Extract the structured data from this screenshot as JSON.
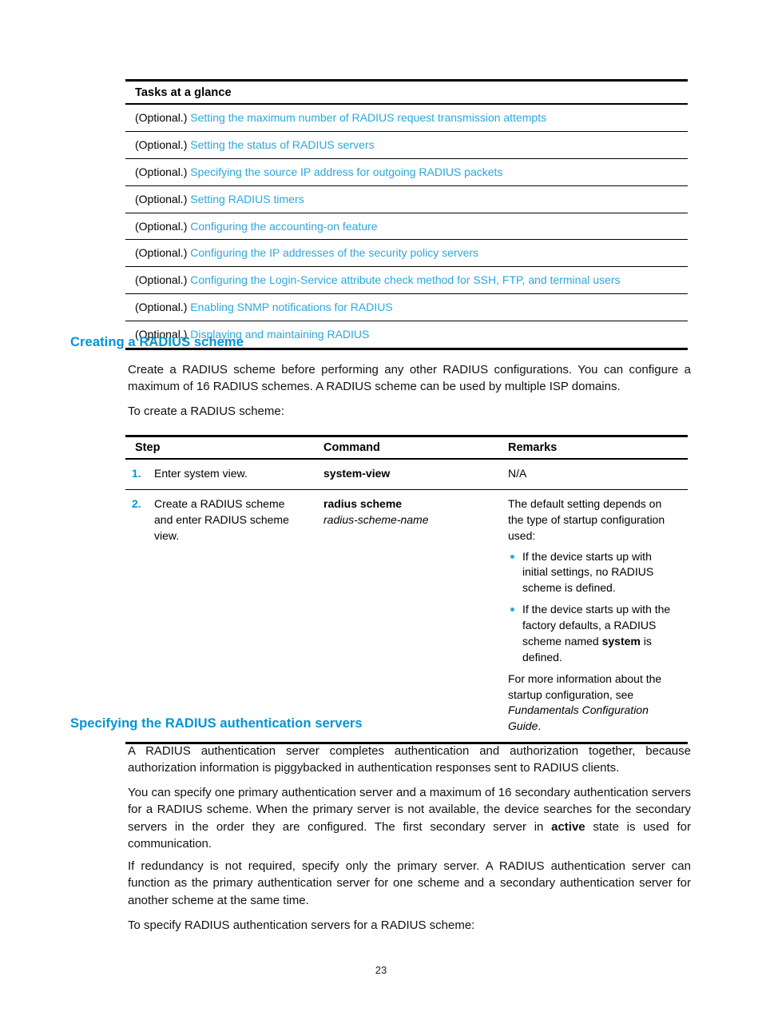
{
  "tasks_table": {
    "header": "Tasks at a glance",
    "rows": [
      {
        "optional": "(Optional.)",
        "link": "Setting the maximum number of RADIUS request transmission attempts"
      },
      {
        "optional": "(Optional.)",
        "link": "Setting the status of RADIUS servers"
      },
      {
        "optional": "(Optional.)",
        "link": "Specifying the source IP address for outgoing RADIUS packets"
      },
      {
        "optional": "(Optional.)",
        "link": "Setting RADIUS timers"
      },
      {
        "optional": "(Optional.)",
        "link": "Configuring the accounting-on feature"
      },
      {
        "optional": "(Optional.)",
        "link": "Configuring the IP addresses of the security policy servers"
      },
      {
        "optional": "(Optional.)",
        "link": "Configuring the Login-Service attribute check method for SSH, FTP, and terminal users"
      },
      {
        "optional": "(Optional.)",
        "link": "Enabling SNMP notifications for RADIUS"
      },
      {
        "optional": "(Optional.)",
        "link": "Displaying and maintaining RADIUS"
      }
    ]
  },
  "creating_scheme": {
    "heading": "Creating a RADIUS scheme",
    "para1": "Create a RADIUS scheme before performing any other RADIUS configurations. You can configure a maximum of 16 RADIUS schemes. A RADIUS scheme can be used by multiple ISP domains.",
    "para2": "To create a RADIUS scheme:"
  },
  "steps_table": {
    "columns": [
      "Step",
      "Command",
      "Remarks"
    ],
    "rows": [
      {
        "num": "1.",
        "step": "Enter system view.",
        "command_bold": "system-view",
        "command_italic": "",
        "remarks_intro": "N/A",
        "remarks_bullets": [],
        "remarks_tail": ""
      },
      {
        "num": "2.",
        "step": "Create a RADIUS scheme and enter RADIUS scheme view.",
        "command_bold": "radius scheme",
        "command_italic": "radius-scheme-name",
        "remarks_intro": "The default setting depends on the type of startup configuration used:",
        "remarks_bullets": [
          {
            "pre": "If the device starts up with initial settings, no RADIUS scheme is defined.",
            "bold": "",
            "post": ""
          },
          {
            "pre": "If the device starts up with the factory defaults, a RADIUS scheme named ",
            "bold": "system",
            "post": " is defined."
          }
        ],
        "remarks_tail_pre": "For more information about the startup configuration, see ",
        "remarks_tail_italic": "Fundamentals Configuration Guide",
        "remarks_tail_post": "."
      }
    ]
  },
  "specifying_servers": {
    "heading": "Specifying the RADIUS authentication servers",
    "para1": "A RADIUS authentication server completes authentication and authorization together, because authorization information is piggybacked in authentication responses sent to RADIUS clients.",
    "para2_pre": "You can specify one primary authentication server and a maximum of 16 secondary authentication servers for a RADIUS scheme. When the primary server is not available, the device searches for the secondary servers in the order they are configured. The first secondary server in ",
    "para2_bold": "active",
    "para2_post": " state is used for communication.",
    "para3": "If redundancy is not required, specify only the primary server. A RADIUS authentication server can function as the primary authentication server for one scheme and a secondary authentication server for another scheme at the same time.",
    "para4": "To specify RADIUS authentication servers for a RADIUS scheme:"
  },
  "footer": {
    "page_number": "23"
  },
  "colors": {
    "link": "#29a8de",
    "heading": "#0095d5",
    "bullet": "#29a8de",
    "text": "#000000"
  }
}
